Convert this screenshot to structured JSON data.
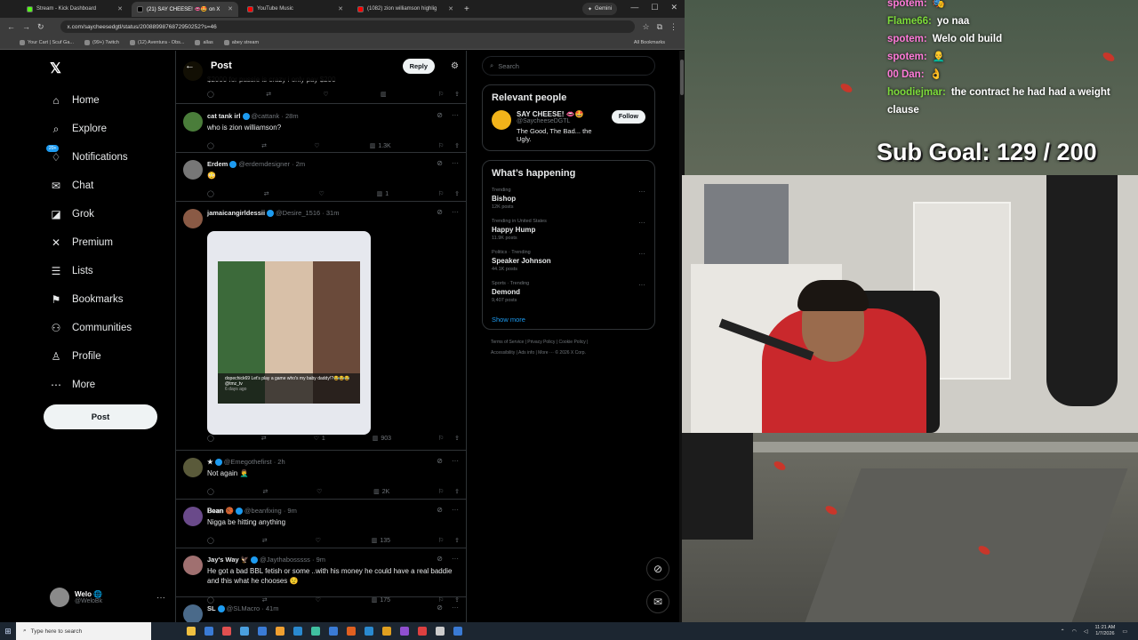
{
  "browser": {
    "tabs": [
      {
        "label": "Stream - Kick Dashboard",
        "color": "#53fc18"
      },
      {
        "label": "(21) SAY CHEESE! 👄🤩 on X",
        "color": "#000000",
        "active": true
      },
      {
        "label": "YouTube Music",
        "color": "#ff0000"
      },
      {
        "label": "(1082) zion williamson highlig",
        "color": "#ff0000"
      }
    ],
    "gemini_label": "Gemini",
    "url": "x.com/saycheesedgtl/status/2008899876872950252?s=46",
    "bookmarks": [
      {
        "label": "Your Cart | Scuf Ga..."
      },
      {
        "label": "(99+) Twitch"
      },
      {
        "label": "(12) Aventura - Obs..."
      },
      {
        "label": "allas"
      },
      {
        "label": "abey stream"
      }
    ],
    "all_bookmarks": "All Bookmarks"
  },
  "sidebar": {
    "items": [
      {
        "label": "Home",
        "icon": "home-icon",
        "glyph": "⌂"
      },
      {
        "label": "Explore",
        "icon": "search-icon",
        "glyph": "⌕"
      },
      {
        "label": "Notifications",
        "icon": "bell-icon",
        "glyph": "♢"
      },
      {
        "label": "Chat",
        "icon": "mail-icon",
        "glyph": "✉"
      },
      {
        "label": "Grok",
        "icon": "grok-icon",
        "glyph": "◪"
      },
      {
        "label": "Premium",
        "icon": "x-icon",
        "glyph": "✕"
      },
      {
        "label": "Lists",
        "icon": "list-icon",
        "glyph": "☰"
      },
      {
        "label": "Bookmarks",
        "icon": "bookmark-icon",
        "glyph": "⚑"
      },
      {
        "label": "Communities",
        "icon": "people-icon",
        "glyph": "⚇"
      },
      {
        "label": "Profile",
        "icon": "person-icon",
        "glyph": "♙"
      },
      {
        "label": "More",
        "icon": "more-icon",
        "glyph": "⋯"
      }
    ],
    "notif_badge": "20+",
    "post_label": "Post",
    "user": {
      "name": "Welo 🌐",
      "handle": "@WeloBk"
    }
  },
  "main": {
    "title": "Post",
    "reply_label": "Reply",
    "top_text": "$2000 for pussie is crazy i only pay $200",
    "tweets": [
      {
        "name": "cat tank irl",
        "handle": "@cattank",
        "time": "28m",
        "text": "who is zion williamson?",
        "views": "1.3K",
        "likes": "",
        "avatar_color": "#4a7d3a"
      },
      {
        "name": "Erdem",
        "handle": "@erdemdesigner",
        "time": "2m",
        "text": "😳",
        "views": "1",
        "likes": "",
        "avatar_color": "#777777"
      },
      {
        "name": "jamaicangirldessii",
        "handle": "@Desire_1516",
        "time": "31m",
        "text": "",
        "views": "903",
        "likes": "1",
        "avatar_color": "#8a5a45",
        "media_caption": "dopechick69 Let's play a game who's my baby daddy!?😂😂😂 @tmz_tv",
        "media_time": "6 days ago"
      },
      {
        "name": "★",
        "handle": "@Emegothefirst",
        "time": "2h",
        "text": "Not again 🤦‍♂️",
        "views": "2K",
        "likes": "",
        "avatar_color": "#5a5a3a"
      },
      {
        "name": "𝐁𝐞𝐚𝐧 🏀",
        "handle": "@beanfixing",
        "time": "9m",
        "text": "Nigga be hitting anything",
        "views": "135",
        "likes": "",
        "avatar_color": "#6a4a8a"
      },
      {
        "name": "Jay's Way 🦅",
        "handle": "@Jaythabosssss",
        "time": "9m",
        "text": "He got a bad BBL fetish or some ..with his money he could have a real baddie and this what he chooses 😟",
        "views": "175",
        "likes": "",
        "avatar_color": "#a07070"
      },
      {
        "name": "SL",
        "handle": "@SLMacro",
        "time": "41m",
        "text": "",
        "views": "",
        "likes": "",
        "avatar_color": "#4a6a8a"
      }
    ]
  },
  "right": {
    "search_placeholder": "Search",
    "relevant_title": "Relevant people",
    "person": {
      "name": "SAY CHEESE! 👄🤩",
      "handle": "@SaycheeseDGTL",
      "bio": "The Good, The Bad... the Ugly.",
      "follow": "Follow"
    },
    "happening_title": "What’s happening",
    "trends": [
      {
        "cat": "Trending",
        "name": "Bishop",
        "count": "12K posts"
      },
      {
        "cat": "Trending in United States",
        "name": "Happy Hump",
        "count": "11.9K posts"
      },
      {
        "cat": "Politics · Trending",
        "name": "Speaker Johnson",
        "count": "44.1K posts"
      },
      {
        "cat": "Sports · Trending",
        "name": "Demond",
        "count": "9,407 posts"
      }
    ],
    "show_more": "Show more",
    "footer1": "Terms of Service   |   Privacy Policy   |   Cookie Policy   |",
    "footer2": "Accessibility   |   Ads info   |   More ···   © 2026 X Corp."
  },
  "stream": {
    "chat": [
      {
        "user": "spotem:",
        "text": "🎭",
        "color": "#ff7ad9"
      },
      {
        "user": "Flame66:",
        "text": "yo naa",
        "color": "#7ddc3a"
      },
      {
        "user": "spotem:",
        "text": "Welo old build",
        "color": "#ff7ad9"
      },
      {
        "user": "spotem:",
        "text": "👨‍🦲",
        "color": "#ff7ad9"
      },
      {
        "user": "00 Dan:",
        "text": "👌",
        "color": "#ff7ad9"
      },
      {
        "user": "hoodiejmar:",
        "text": "the contract he had had a weight clause",
        "color": "#7ddc3a"
      }
    ],
    "sub_goal": "Sub Goal:  129 / 200"
  },
  "taskbar": {
    "search_placeholder": "Type here to search",
    "time": "11:21 AM",
    "date": "1/7/2026"
  }
}
